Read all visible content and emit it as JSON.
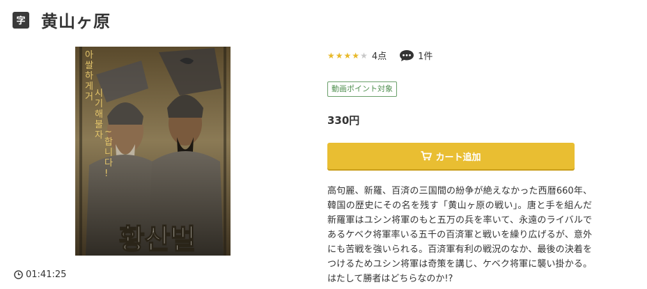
{
  "header": {
    "subtitle_badge": "字",
    "title": "黄山ヶ原"
  },
  "poster": {
    "title_korean": "황산벌",
    "tagline_korean": "아쌀하게 거시기 해불자~ 합니다!"
  },
  "duration": {
    "icon": "clock-icon",
    "text": "01:41:25"
  },
  "rating": {
    "stars_filled": 4,
    "stars_total": 5,
    "score_label": "4点",
    "review_icon": "comment-icon",
    "review_count_label": "1件"
  },
  "point_badge": "動画ポイント対象",
  "price": "330円",
  "cart": {
    "icon": "cart-icon",
    "label": "カート追加"
  },
  "description": "高句麗、新羅、百済の三国間の紛争が絶えなかった西暦660年、韓国の歴史にその名を残す「黄山ヶ原の戦い」。唐と手を組んだ新羅軍はユシン将軍のもと五万の兵を率いて、永遠のライバルであるケベク将軍率いる五千の百済軍と戦いを繰り広げるが、意外にも苦戦を強いられる。百済軍有利の戦況のなか、最後の決着をつけるためユシン将軍は奇策を講じ、ケベク将軍に襲い掛かる。はたして勝者はどちらなのか!?",
  "colors": {
    "accent_button": "#e9be32",
    "star_on": "#e8b92a",
    "star_off": "#c8c8c8",
    "badge_green": "#4f8f4f"
  }
}
